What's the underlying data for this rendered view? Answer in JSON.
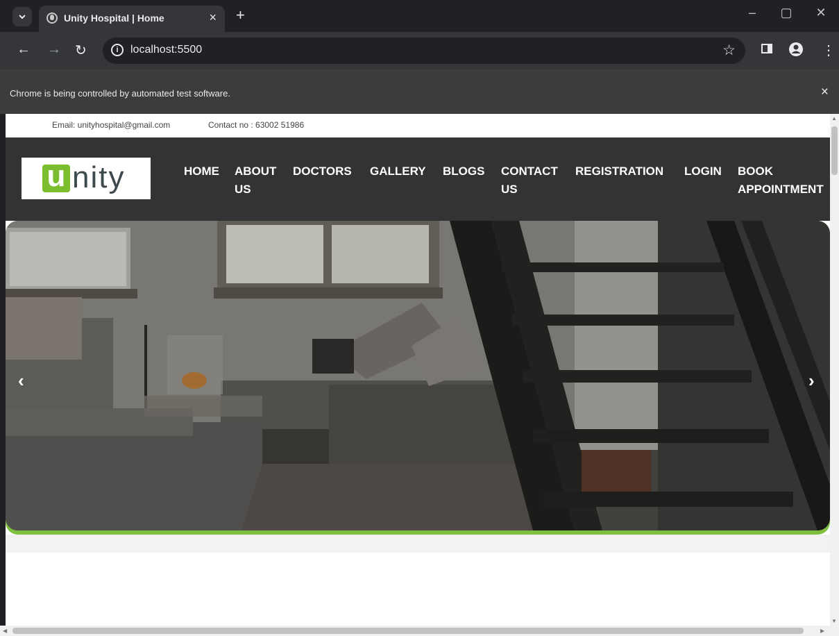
{
  "browser": {
    "tab_title": "Unity Hospital | Home",
    "tab_close": "×",
    "new_tab": "+",
    "url": "localhost:5500",
    "infobar_message": "Chrome is being controlled by automated test software.",
    "infobar_close": "×"
  },
  "page": {
    "topbar": {
      "email": "Email: unityhospital@gmail.com",
      "contact": "Contact no : 63002 51986"
    },
    "logo": {
      "letter": "u",
      "rest": "nity"
    },
    "nav": [
      {
        "line1": "HOME",
        "line2": ""
      },
      {
        "line1": "ABOUT",
        "line2": "US"
      },
      {
        "line1": "DOCTORS",
        "line2": ""
      },
      {
        "line1": "GALLERY",
        "line2": ""
      },
      {
        "line1": "BLOGS",
        "line2": ""
      },
      {
        "line1": "CONTACT",
        "line2": "US"
      },
      {
        "line1": "REGISTRATION",
        "line2": ""
      },
      {
        "line1": "LOGIN",
        "line2": ""
      },
      {
        "line1": "BOOK",
        "line2": "APPOINTMENT"
      }
    ],
    "carousel": {
      "prev": "‹",
      "next": "›"
    }
  },
  "colors": {
    "navbar": "#333333",
    "accent_green": "#7bbd2f",
    "chrome_dark": "#202124"
  }
}
